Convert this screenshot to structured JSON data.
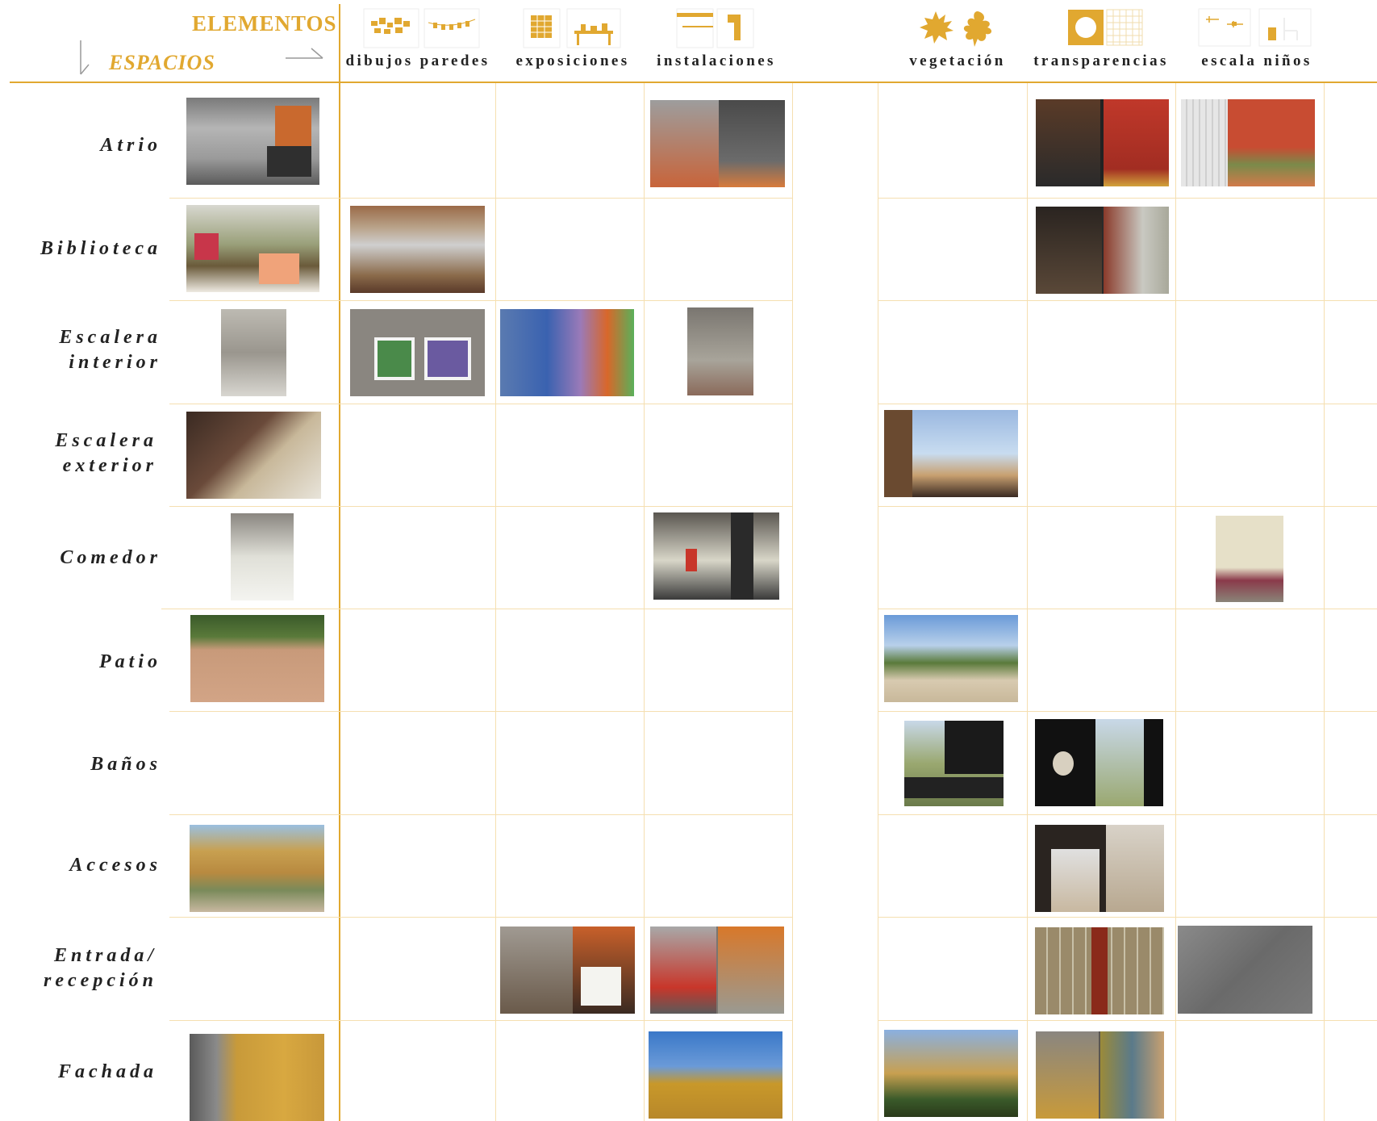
{
  "header": {
    "elementos": "ELEMENTOS",
    "espacios": "ESPACIOS"
  },
  "colors": {
    "accent": "#e1a830",
    "grid": "#f5dfb0",
    "text": "#222222"
  },
  "columns": [
    {
      "label": "dibujos paredes",
      "icons": [
        "wall-drawings-icon",
        "hanging-drawings-icon"
      ]
    },
    {
      "label": "exposiciones",
      "icons": [
        "exhibition-panel-icon",
        "exhibition-table-icon"
      ]
    },
    {
      "label": "instalaciones",
      "icons": [
        "ceiling-duct-icon",
        "wall-duct-icon"
      ]
    },
    {
      "label": "vegetación",
      "icons": [
        "maple-leaf-icon",
        "oak-leaf-icon"
      ]
    },
    {
      "label": "transparencias",
      "icons": [
        "round-window-icon",
        "glass-block-icon"
      ]
    },
    {
      "label": "escala niños",
      "icons": [
        "child-scale-shelf-icon",
        "child-chair-icon"
      ]
    }
  ],
  "rows": [
    {
      "label": [
        "Atrio"
      ]
    },
    {
      "label": [
        "Biblioteca"
      ]
    },
    {
      "label": [
        "Escalera",
        "interior"
      ]
    },
    {
      "label": [
        "Escalera",
        "exterior"
      ]
    },
    {
      "label": [
        "Comedor"
      ]
    },
    {
      "label": [
        "Patio"
      ]
    },
    {
      "label": [
        "Baños"
      ]
    },
    {
      "label": [
        "Accesos"
      ]
    },
    {
      "label": [
        "Entrada/",
        "recepción"
      ]
    },
    {
      "label": [
        "Fachada"
      ]
    }
  ],
  "photos": {
    "atrio-space": "atrium-photo",
    "atrio-instalaciones": "atrium-installations-photo",
    "atrio-transparencias": "atrium-round-windows-photo",
    "atrio-escala": "atrium-child-scale-photo",
    "biblioteca-space": "library-photo",
    "biblioteca-dibujos": "library-drawings-photo",
    "biblioteca-transparencias": "library-glass-photo",
    "esc-int-space": "interior-stair-photo",
    "esc-int-dibujos": "stair-drawings-photo",
    "esc-int-exposiciones": "stair-exhibition-photo",
    "esc-int-instalaciones": "stair-installations-photo",
    "esc-ext-space": "exterior-stair-photo",
    "esc-ext-vegetacion": "exterior-stair-view-photo",
    "comedor-space": "dining-photo",
    "comedor-instalaciones": "dining-installations-photo",
    "comedor-escala": "dining-coat-hooks-photo",
    "patio-space": "patio-court-photo",
    "patio-vegetacion": "patio-trees-photo",
    "banos-vegetacion": "bathroom-view-photo",
    "banos-transparencias": "bathroom-window-photo",
    "accesos-space": "access-photo",
    "accesos-transparencias": "access-glass-photo",
    "entrada-exposiciones": "reception-exhibition-photo",
    "entrada-instalaciones": "reception-installations-photo",
    "entrada-transparencias": "reception-glass-photo",
    "entrada-escala": "reception-floor-sign-photo",
    "fachada-space": "facade-photo",
    "fachada-instalaciones": "facade-vents-photo",
    "fachada-vegetacion": "facade-vegetation-photo",
    "fachada-transparencias": "facade-glass-photo"
  }
}
